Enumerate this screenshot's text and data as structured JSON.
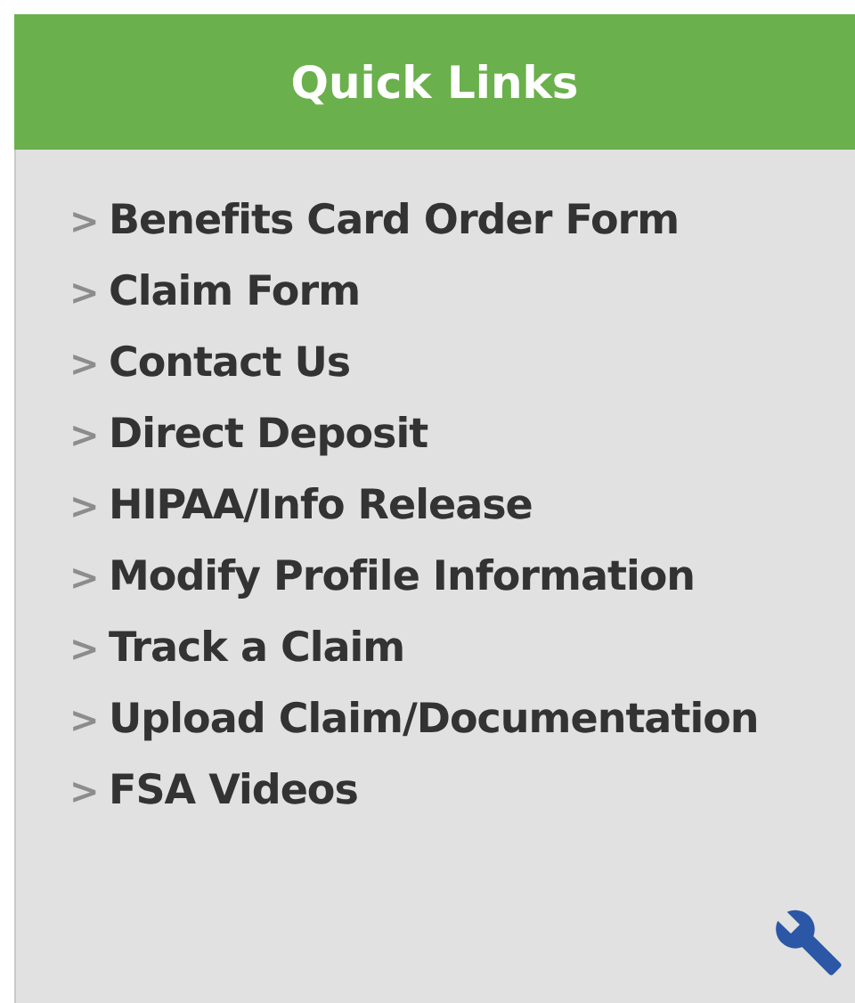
{
  "header": {
    "title": "Quick Links"
  },
  "links": [
    {
      "bullet": ">",
      "label": "Benefits Card Order Form"
    },
    {
      "bullet": ">",
      "label": "Claim Form"
    },
    {
      "bullet": ">",
      "label": "Contact Us"
    },
    {
      "bullet": ">",
      "label": "Direct Deposit"
    },
    {
      "bullet": ">",
      "label": "HIPAA/Info Release"
    },
    {
      "bullet": ">",
      "label": "Modify Profile Information"
    },
    {
      "bullet": ">",
      "label": "Track a Claim"
    },
    {
      "bullet": ">",
      "label": "Upload Claim/Documentation"
    },
    {
      "bullet": ">",
      "label": "FSA Videos"
    }
  ]
}
